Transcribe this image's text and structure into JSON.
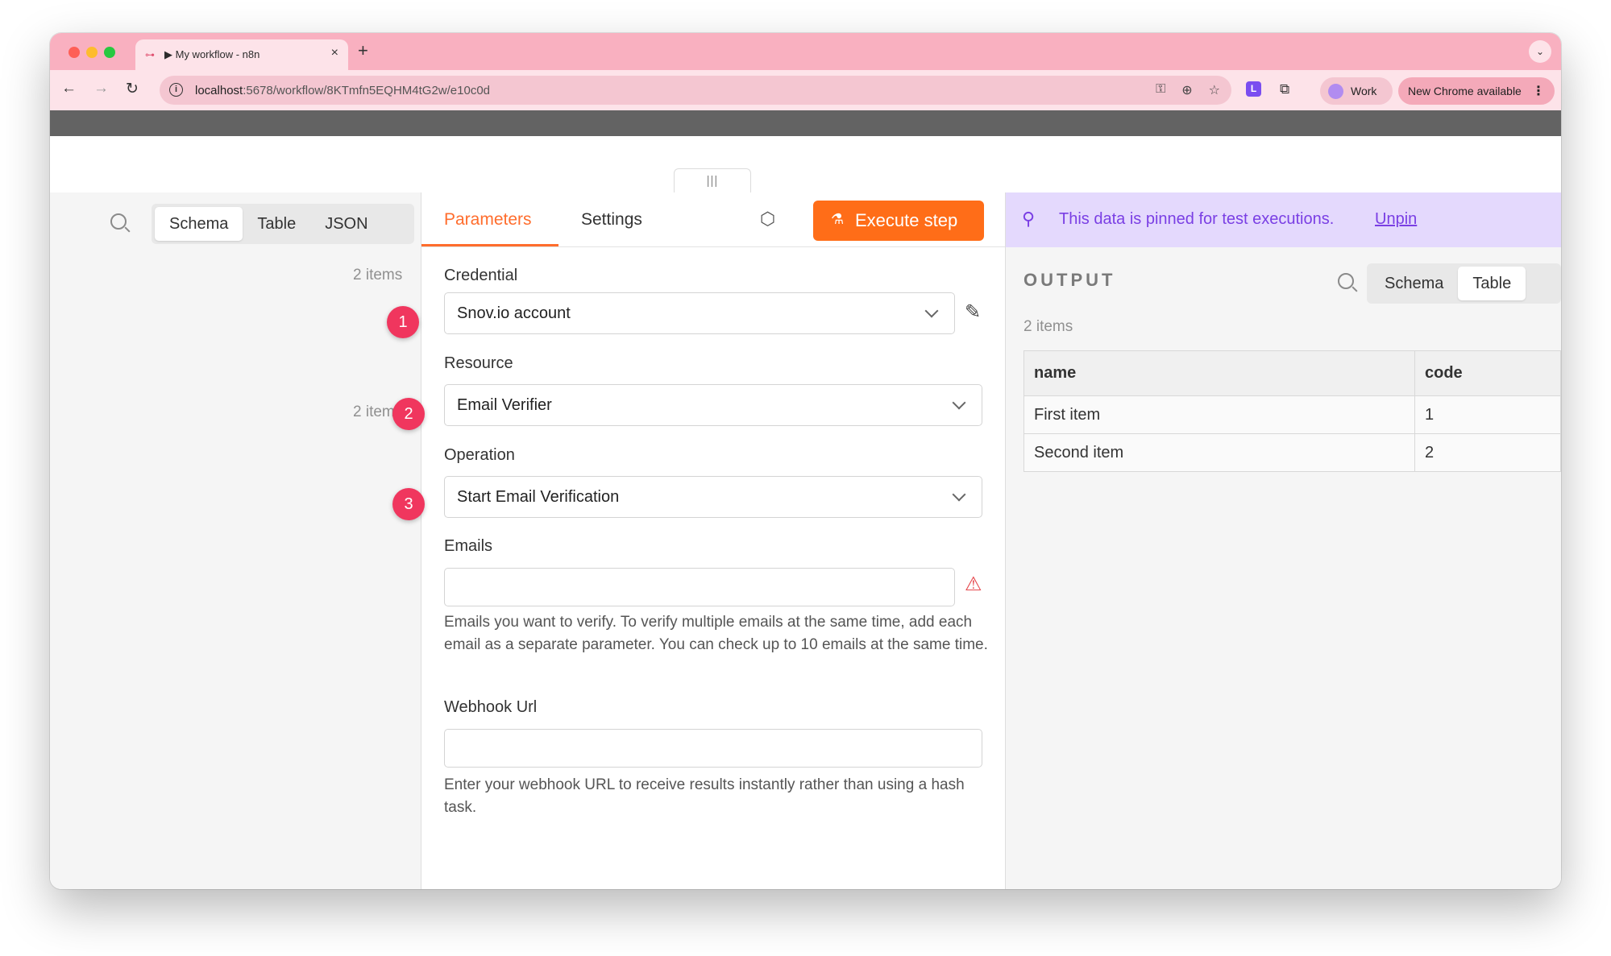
{
  "browser": {
    "tab_title": "▶ My workflow - n8n",
    "tab_logo": "n8n-logo",
    "close_glyph": "×",
    "new_tab_glyph": "+",
    "tab_menu_glyph": "⌄",
    "url_host": "localhost",
    "url_path": ":5678/workflow/8KTmfn5EQHM4tG2w/e10c0d",
    "profile_label": "Work",
    "update_label": "New Chrome available",
    "menu_glyph": "⋮",
    "nav": {
      "back": "←",
      "forward": "→",
      "reload": "↻"
    },
    "omni_icons": [
      "key-icon",
      "zoom-icon",
      "star-icon"
    ],
    "omni_glyphs": {
      "key": "⚿",
      "zoom": "⊕",
      "star": "☆"
    },
    "ext_glyphs": {
      "l": "L",
      "puzzle": "⧉"
    },
    "info_glyph": "i"
  },
  "canvas": {
    "drag_handle_glyph": "|||"
  },
  "input_panel": {
    "view_tabs": [
      "Schema",
      "Table",
      "JSON"
    ],
    "active_view": "Schema",
    "items_top": "2 items",
    "items_mid": "2 items"
  },
  "params_panel": {
    "tabs": {
      "parameters": "Parameters",
      "settings": "Settings"
    },
    "active_tab": "Parameters",
    "cube_glyph": "⬡",
    "execute_label": "Execute step",
    "flask_glyph": "⚗",
    "credential": {
      "label": "Credential",
      "value": "Snov.io account",
      "edit_glyph": "✎"
    },
    "resource": {
      "label": "Resource",
      "value": "Email Verifier"
    },
    "operation": {
      "label": "Operation",
      "value": "Start Email Verification"
    },
    "emails": {
      "label": "Emails",
      "value": "",
      "warn_glyph": "⚠",
      "hint": "Emails you want to verify. To verify multiple emails at the same time, add each email as a separate parameter. You can check up to 10 emails at the same time."
    },
    "webhook": {
      "label": "Webhook Url",
      "value": "",
      "hint": "Enter your webhook URL to receive results instantly rather than using a hash task."
    }
  },
  "output_panel": {
    "pinned_text": "This data is pinned for test executions.",
    "unpin_label": "Unpin",
    "pin_glyph": "⚲",
    "title": "OUTPUT",
    "view_tabs": [
      "Schema",
      "Table"
    ],
    "active_view": "Table",
    "items_count": "2 items",
    "table": {
      "columns": [
        "name",
        "code"
      ],
      "rows": [
        [
          "First item",
          "1"
        ],
        [
          "Second item",
          "2"
        ]
      ]
    }
  },
  "callouts": [
    "1",
    "2",
    "3"
  ],
  "colors": {
    "accent_orange": "#ff6d18",
    "pin_purple": "#7a3fe4",
    "callout_red": "#f0365e",
    "chrome_pink": "#f9b0c0"
  }
}
